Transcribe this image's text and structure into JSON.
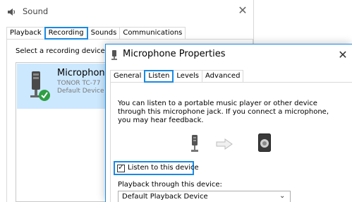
{
  "sound_window": {
    "title": "Sound",
    "close_glyph": "✕",
    "tabs": [
      {
        "label": "Playback"
      },
      {
        "label": "Recording"
      },
      {
        "label": "Sounds"
      },
      {
        "label": "Communications"
      }
    ],
    "active_tab": "Recording",
    "instruction": "Select a recording device b",
    "device": {
      "name": "Microphone",
      "line1": "TONOR TC-77",
      "line2": "Default Device",
      "status_icon": "green-check-icon"
    }
  },
  "props_window": {
    "title": "Microphone Properties",
    "close_glyph": "✕",
    "tabs": [
      {
        "label": "General"
      },
      {
        "label": "Listen"
      },
      {
        "label": "Levels"
      },
      {
        "label": "Advanced"
      }
    ],
    "active_tab": "Listen",
    "description": "You can listen to a portable music player or other device through this microphone jack.  If you connect a microphone, you may hear feedback.",
    "listen_checkbox": {
      "label": "Listen to this device",
      "checked": true,
      "checkmark_glyph": "✓"
    },
    "playback_label": "Playback through this device:",
    "playback_select": {
      "value": "Default Playback Device",
      "chevron_glyph": "⌄"
    }
  },
  "colors": {
    "accent": "#1a8ae3",
    "selected_row": "#cce8ff",
    "status_green": "#2ea043"
  }
}
